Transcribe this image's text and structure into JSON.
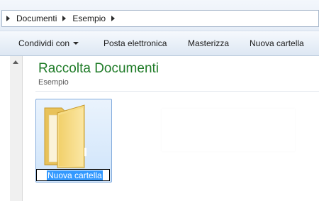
{
  "breadcrumb": {
    "items": [
      "Documenti",
      "Esempio"
    ]
  },
  "toolbar": {
    "share_label": "Condividi con",
    "email_label": "Posta elettronica",
    "burn_label": "Masterizza",
    "new_folder_label": "Nuova cartella"
  },
  "library": {
    "title": "Raccolta Documenti",
    "subtitle": "Esempio"
  },
  "folder": {
    "name_edit_value": "Nuova cartella",
    "icon": "folder-icon"
  },
  "colors": {
    "title_green": "#1e7b27",
    "selection_blue": "#3399ff",
    "tile_border": "#84acdd"
  }
}
